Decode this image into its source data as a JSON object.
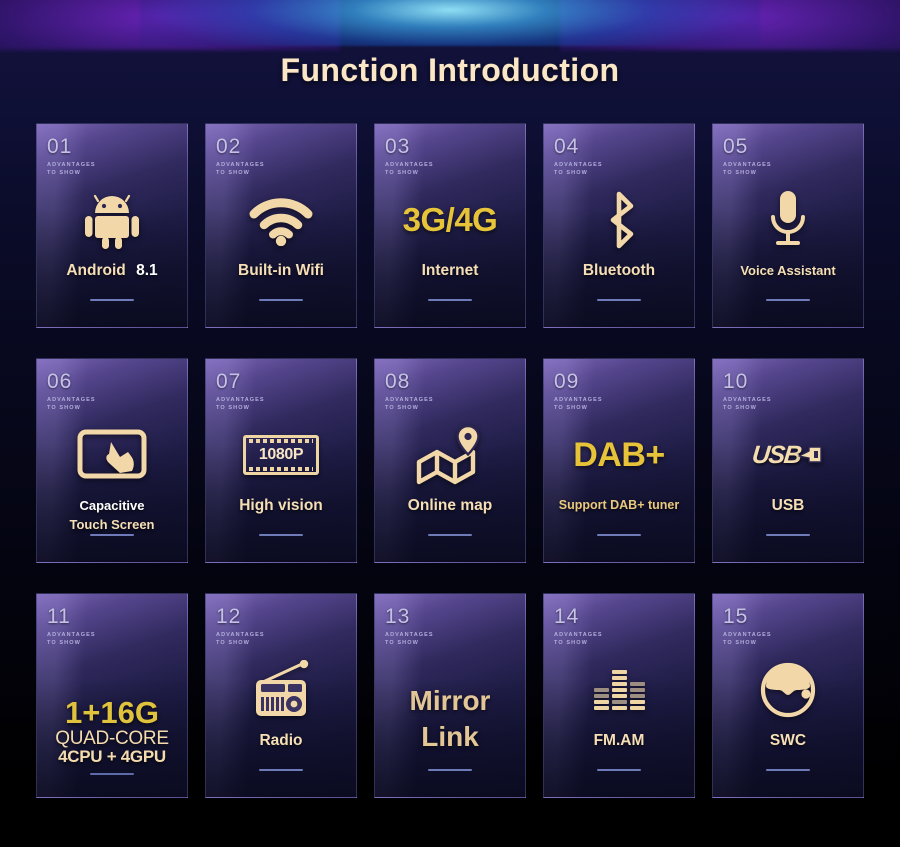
{
  "page": {
    "title": "Function Introduction",
    "background_color": "#000000",
    "accent_gold": "#f6dfb6",
    "accent_yellow": "#e6c338",
    "divider_color": "#6e7bb8",
    "card_number_color": "#c6c2e6"
  },
  "card_common": {
    "subtitle_line1": "ADVANTAGES",
    "subtitle_line2": "TO SHOW"
  },
  "cards": [
    {
      "num": "01",
      "icon": "android-robot-icon",
      "label": "Android",
      "label2": "8.1",
      "style": "android"
    },
    {
      "num": "02",
      "icon": "wifi-icon",
      "label": "Built-in Wifi",
      "style": "plain"
    },
    {
      "num": "03",
      "icon": "text-3g4g-icon",
      "icon_text": "3G/4G",
      "label": "Internet",
      "style": "text-icon"
    },
    {
      "num": "04",
      "icon": "bluetooth-icon",
      "label": "Bluetooth",
      "style": "plain"
    },
    {
      "num": "05",
      "icon": "microphone-icon",
      "label": "Voice Assistant",
      "style": "plain"
    },
    {
      "num": "06",
      "icon": "touch-screen-icon",
      "label": "Capacitive",
      "label2": "Touch Screen",
      "style": "two-line"
    },
    {
      "num": "07",
      "icon": "film-strip-1080p-icon",
      "icon_text": "1080P",
      "label": "High vision",
      "style": "film"
    },
    {
      "num": "08",
      "icon": "map-pin-icon",
      "label": "Online map",
      "style": "plain"
    },
    {
      "num": "09",
      "icon": "text-dabplus-icon",
      "icon_text": "DAB+",
      "label": "Support DAB+ tuner",
      "style": "text-icon-small-label"
    },
    {
      "num": "10",
      "icon": "usb-logo-icon",
      "icon_text": "USB",
      "label": "USB",
      "style": "usb"
    },
    {
      "num": "11",
      "icon": "memory-spec-icon",
      "line1": "1+16G",
      "line2": "QUAD-CORE",
      "line3": "4CPU + 4GPU",
      "style": "spec-stack"
    },
    {
      "num": "12",
      "icon": "radio-icon",
      "label": "Radio",
      "style": "plain"
    },
    {
      "num": "13",
      "icon": "mirror-link-text-icon",
      "line1": "Mirror",
      "line2": "Link",
      "style": "mirror"
    },
    {
      "num": "14",
      "icon": "equalizer-icon",
      "label": "FM.AM",
      "style": "plain"
    },
    {
      "num": "15",
      "icon": "steering-wheel-icon",
      "label": "SWC",
      "style": "plain"
    }
  ]
}
